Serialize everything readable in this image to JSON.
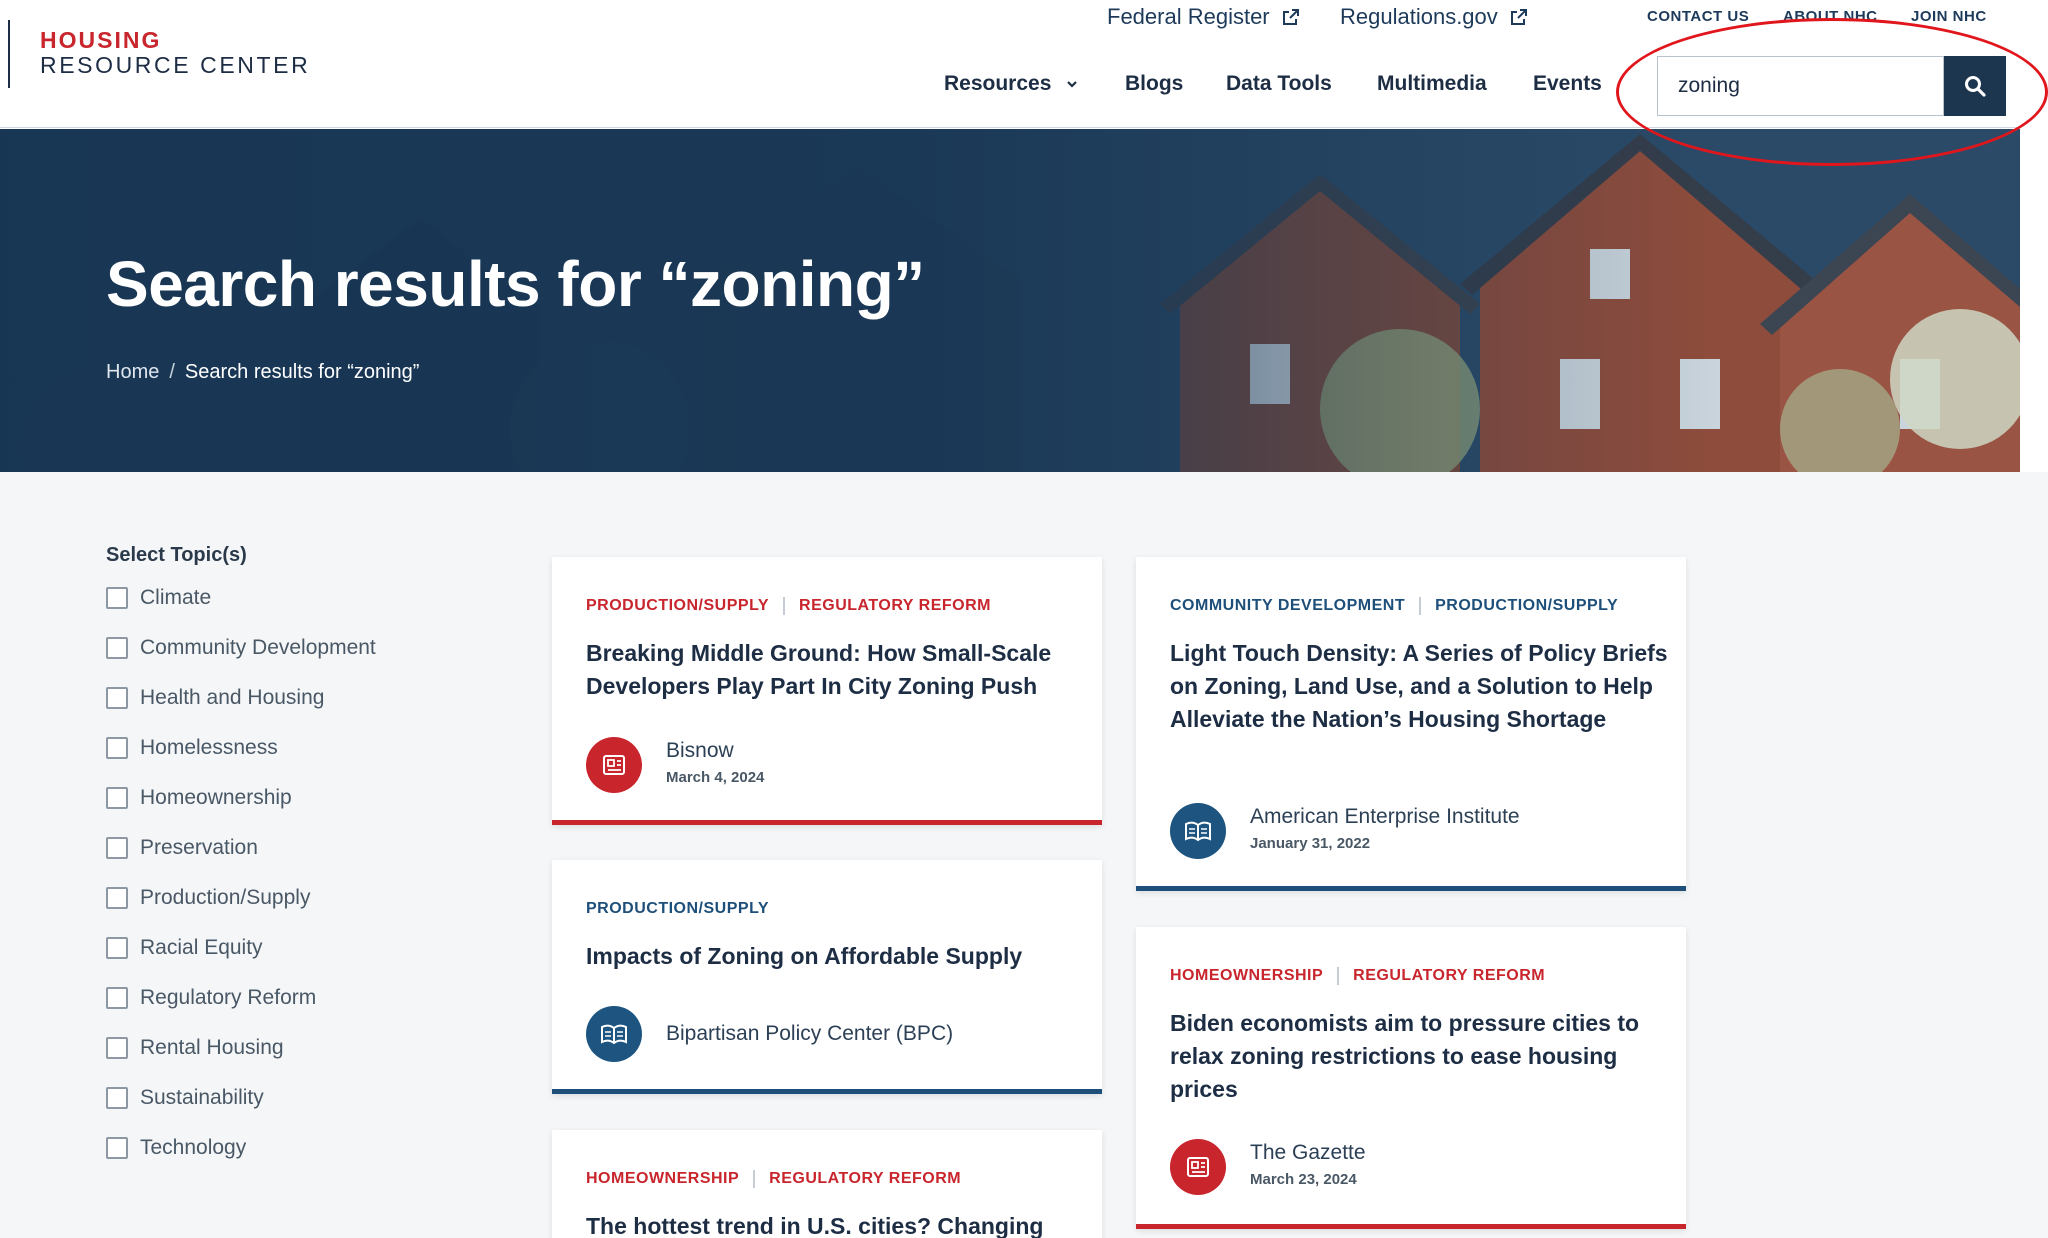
{
  "logo": {
    "line1": "HOUSING",
    "line2": "RESOURCE CENTER"
  },
  "utility_links": [
    {
      "label": "Federal Register"
    },
    {
      "label": "Regulations.gov"
    }
  ],
  "top_links": [
    "CONTACT US",
    "ABOUT NHC",
    "JOIN NHC"
  ],
  "nav": {
    "items": [
      "Resources",
      "Blogs",
      "Data Tools",
      "Multimedia",
      "Events"
    ]
  },
  "search": {
    "value": "zoning",
    "button_icon": "search-icon"
  },
  "hero": {
    "title": "Search results for “zoning”",
    "breadcrumb": {
      "home": "Home",
      "separator": "/",
      "current": "Search results for “zoning”"
    }
  },
  "filters": {
    "title": "Select Topic(s)",
    "options": [
      "Climate",
      "Community Development",
      "Health and Housing",
      "Homelessness",
      "Homeownership",
      "Preservation",
      "Production/Supply",
      "Racial Equity",
      "Regulatory Reform",
      "Rental Housing",
      "Sustainability",
      "Technology"
    ]
  },
  "results": [
    {
      "tags": [
        "PRODUCTION/SUPPLY",
        "REGULATORY REFORM"
      ],
      "title": "Breaking Middle Ground: How Small-Scale Developers Play Part In City Zoning Push",
      "source": "Bisnow",
      "date": "March 4, 2024",
      "icon": "newspaper-icon",
      "accent": "#c8252d"
    },
    {
      "tags": [
        "PRODUCTION/SUPPLY"
      ],
      "title": "Impacts of Zoning on Affordable Supply",
      "source": "Bipartisan Policy Center (BPC)",
      "date": "",
      "icon": "open-book-icon",
      "accent": "#1d4f7a"
    },
    {
      "tags": [
        "HOMEOWNERSHIP",
        "REGULATORY REFORM"
      ],
      "title": "The hottest trend in U.S. cities? Changing",
      "source": "",
      "date": "",
      "icon": "",
      "accent": "#c8252d"
    },
    {
      "tags": [
        "COMMUNITY DEVELOPMENT",
        "PRODUCTION/SUPPLY"
      ],
      "title": "Light Touch Density: A Series of Policy Briefs on Zoning, Land Use, and a Solution to Help Alleviate the Nation’s Housing Shortage",
      "source": "American Enterprise Institute",
      "date": "January 31, 2022",
      "icon": "open-book-icon",
      "accent": "#1d4f7a"
    },
    {
      "tags": [
        "HOMEOWNERSHIP",
        "REGULATORY REFORM"
      ],
      "title": "Biden economists aim to pressure cities to relax zoning restrictions to ease housing prices",
      "source": "The Gazette",
      "date": "March 23, 2024",
      "icon": "newspaper-icon",
      "accent": "#c8252d"
    }
  ],
  "colors": {
    "brand_red": "#c8252d",
    "brand_navy": "#1d3650",
    "annotation_oval": "#e0161c"
  }
}
